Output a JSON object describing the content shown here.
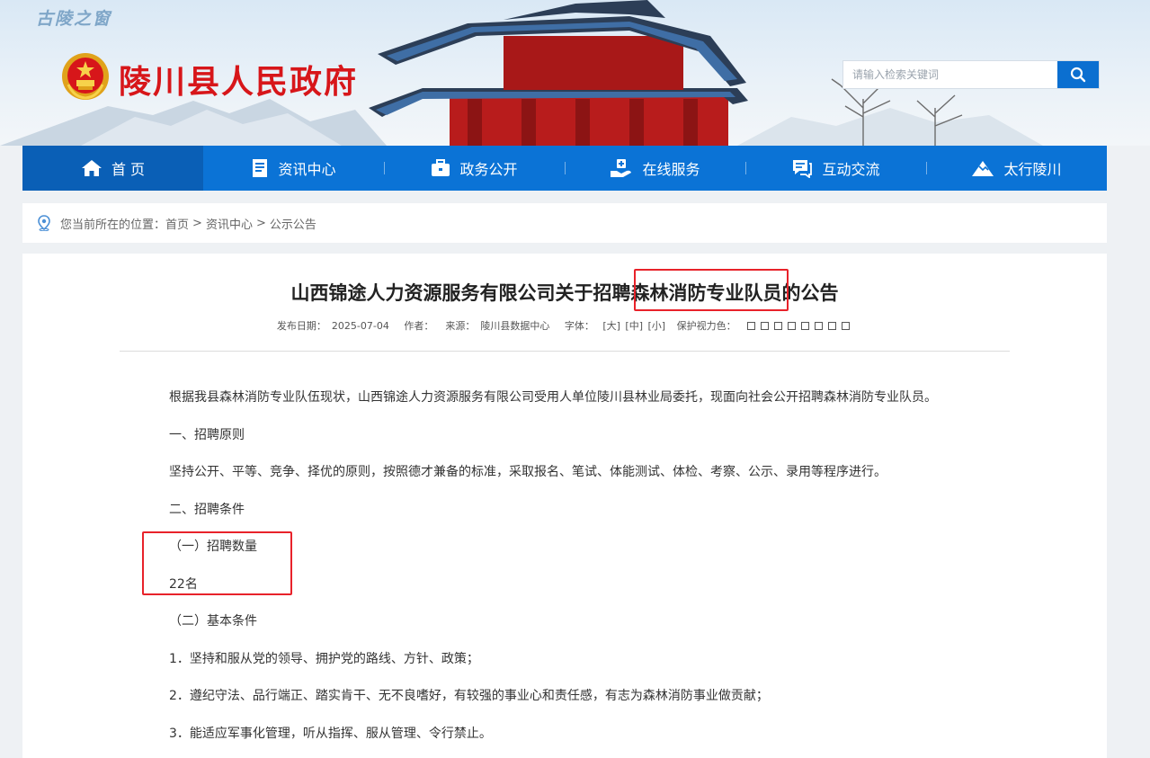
{
  "header": {
    "slogan": "古陵之窗",
    "site_title": "陵川县人民政府",
    "search": {
      "placeholder": "请输入检索关键词"
    }
  },
  "nav": {
    "items": [
      {
        "label": "首 页",
        "icon": "home-icon"
      },
      {
        "label": "资讯中心",
        "icon": "document-icon"
      },
      {
        "label": "政务公开",
        "icon": "briefcase-icon"
      },
      {
        "label": "在线服务",
        "icon": "service-icon"
      },
      {
        "label": "互动交流",
        "icon": "chat-icon"
      },
      {
        "label": "太行陵川",
        "icon": "mountain-icon"
      }
    ]
  },
  "breadcrumb": {
    "prefix": "您当前所在的位置：",
    "items": [
      "首页",
      "资讯中心",
      "公示公告"
    ],
    "separator": ">"
  },
  "article": {
    "title": "山西锦途人力资源服务有限公司关于招聘森林消防专业队员的公告",
    "meta": {
      "date_label": "发布日期：",
      "date": "2025-07-04",
      "author_label": "作者：",
      "source_label": "来源：",
      "source": "陵川县数据中心",
      "font_label": "字体：",
      "font_large": "[大]",
      "font_medium": "[中]",
      "font_small": "[小]",
      "eye_label": "保护视力色："
    },
    "paragraphs": [
      "根据我县森林消防专业队伍现状，山西锦途人力资源服务有限公司受用人单位陵川县林业局委托，现面向社会公开招聘森林消防专业队员。",
      "一、招聘原则",
      "坚持公开、平等、竞争、择优的原则，按照德才兼备的标准，采取报名、笔试、体能测试、体检、考察、公示、录用等程序进行。",
      "二、招聘条件",
      "（一）招聘数量",
      "22名",
      "（二）基本条件",
      "1．坚持和服从党的领导、拥护党的路线、方针、政策；",
      "2．遵纪守法、品行端正、踏实肯干、无不良嗜好，有较强的事业心和责任感，有志为森林消防事业做贡献；",
      "3．能适应军事化管理，听从指挥、服从管理、令行禁止。"
    ]
  },
  "colors": {
    "nav_blue": "#0b73d6",
    "nav_active": "#0a5fb6",
    "title_red": "#d7161a",
    "highlight_red": "#e8222a"
  }
}
